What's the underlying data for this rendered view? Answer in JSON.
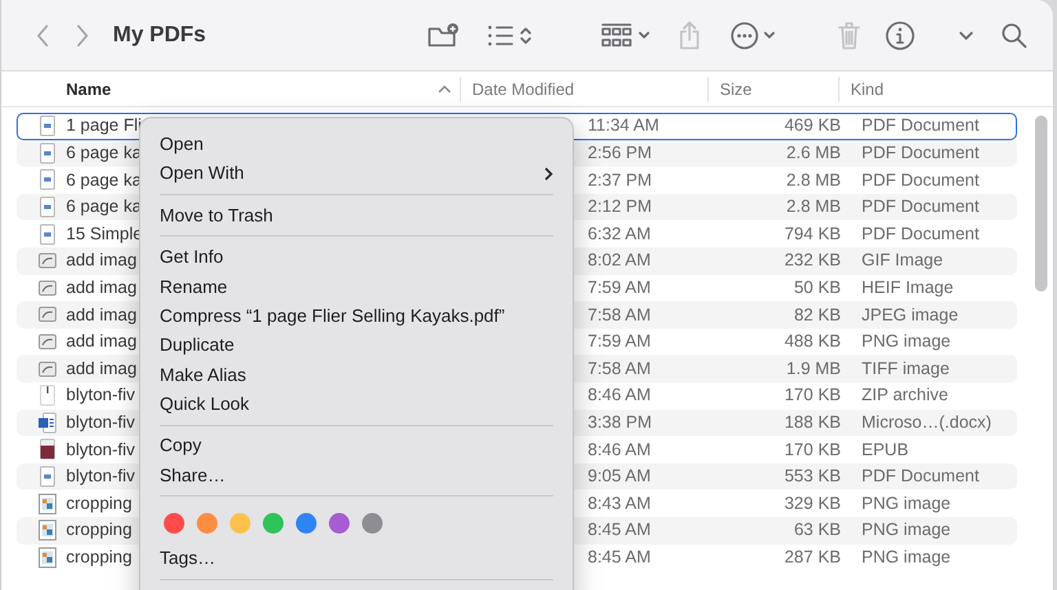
{
  "toolbar": {
    "title": "My PDFs",
    "buttons": [
      {
        "kind": "back",
        "disabled": false
      },
      {
        "kind": "forward",
        "disabled": false
      },
      {
        "kind": "new-folder",
        "disabled": false
      },
      {
        "kind": "view",
        "disabled": false
      },
      {
        "kind": "group",
        "disabled": false
      },
      {
        "kind": "share",
        "disabled": true
      },
      {
        "kind": "more",
        "disabled": false
      },
      {
        "kind": "trash",
        "disabled": true
      },
      {
        "kind": "info",
        "disabled": false
      },
      {
        "kind": "expand",
        "disabled": false
      },
      {
        "kind": "search",
        "disabled": false
      }
    ]
  },
  "columns": [
    {
      "label": "Name",
      "sorted": true
    },
    {
      "label": "Date Modified",
      "sorted": false
    },
    {
      "label": "Size",
      "sorted": false
    },
    {
      "label": "Kind",
      "sorted": false
    }
  ],
  "rows": [
    {
      "kind": "pdf",
      "name": "1 page Fli",
      "date": "11:34 AM",
      "size": "469 KB",
      "type": "PDF Document",
      "selected": true
    },
    {
      "kind": "pdf",
      "name": "6 page ka",
      "date": "2:56 PM",
      "size": "2.6 MB",
      "type": "PDF Document",
      "selected": false
    },
    {
      "kind": "pdf",
      "name": "6 page ka",
      "date": "2:37 PM",
      "size": "2.8 MB",
      "type": "PDF Document",
      "selected": false
    },
    {
      "kind": "pdf",
      "name": "6 page ka",
      "date": "2:12 PM",
      "size": "2.8 MB",
      "type": "PDF Document",
      "selected": false
    },
    {
      "kind": "pdf",
      "name": "15 Simple",
      "date": "6:32 AM",
      "size": "794 KB",
      "type": "PDF Document",
      "selected": false
    },
    {
      "kind": "image",
      "name": "add imag",
      "date": "8:02 AM",
      "size": "232 KB",
      "type": "GIF Image",
      "selected": false
    },
    {
      "kind": "image",
      "name": "add imag",
      "date": "7:59 AM",
      "size": "50 KB",
      "type": "HEIF Image",
      "selected": false
    },
    {
      "kind": "image",
      "name": "add imag",
      "date": "7:58 AM",
      "size": "82 KB",
      "type": "JPEG image",
      "selected": false
    },
    {
      "kind": "image",
      "name": "add imag",
      "date": "7:59 AM",
      "size": "488 KB",
      "type": "PNG image",
      "selected": false
    },
    {
      "kind": "image",
      "name": "add imag",
      "date": "7:58 AM",
      "size": "1.9 MB",
      "type": "TIFF image",
      "selected": false
    },
    {
      "kind": "zip",
      "name": "blyton-fiv",
      "date": "8:46 AM",
      "size": "170 KB",
      "type": "ZIP archive",
      "selected": false
    },
    {
      "kind": "word",
      "name": "blyton-fiv",
      "date": "3:38 PM",
      "size": "188 KB",
      "type": "Microso…(.docx)",
      "selected": false
    },
    {
      "kind": "epub",
      "name": "blyton-fiv",
      "date": "8:46 AM",
      "size": "170 KB",
      "type": "EPUB",
      "selected": false
    },
    {
      "kind": "pdf",
      "name": "blyton-fiv",
      "date": "9:05 AM",
      "size": "553 KB",
      "type": "PDF Document",
      "selected": false
    },
    {
      "kind": "thumb",
      "name": "cropping",
      "date": "8:43 AM",
      "size": "329 KB",
      "type": "PNG image",
      "selected": false
    },
    {
      "kind": "thumb",
      "name": "cropping",
      "date": "8:45 AM",
      "size": "63 KB",
      "type": "PNG image",
      "selected": false
    },
    {
      "kind": "thumb",
      "name": "cropping",
      "date": "8:45 AM",
      "size": "287 KB",
      "type": "PNG image",
      "selected": false
    }
  ],
  "context_menu": {
    "items": [
      {
        "kind": "item",
        "label": "Open"
      },
      {
        "kind": "submenu",
        "label": "Open With"
      },
      {
        "kind": "separator"
      },
      {
        "kind": "item",
        "label": "Move to Trash"
      },
      {
        "kind": "separator"
      },
      {
        "kind": "item",
        "label": "Get Info"
      },
      {
        "kind": "item",
        "label": "Rename"
      },
      {
        "kind": "item",
        "label": "Compress “1 page Flier Selling Kayaks.pdf”"
      },
      {
        "kind": "item",
        "label": "Duplicate"
      },
      {
        "kind": "item",
        "label": "Make Alias"
      },
      {
        "kind": "item",
        "label": "Quick Look"
      },
      {
        "kind": "separator"
      },
      {
        "kind": "item",
        "label": "Copy"
      },
      {
        "kind": "item",
        "label": "Share…"
      },
      {
        "kind": "separator"
      },
      {
        "kind": "tags",
        "tags": [
          {
            "color": "#fe4c4c"
          },
          {
            "color": "#fd8d42"
          },
          {
            "color": "#fdc14c"
          },
          {
            "color": "#2fc35a"
          },
          {
            "color": "#2f84f4"
          },
          {
            "color": "#a85cd2"
          },
          {
            "color": "#8e8e92"
          }
        ]
      },
      {
        "kind": "item",
        "label": "Tags…"
      },
      {
        "kind": "separator"
      }
    ]
  }
}
